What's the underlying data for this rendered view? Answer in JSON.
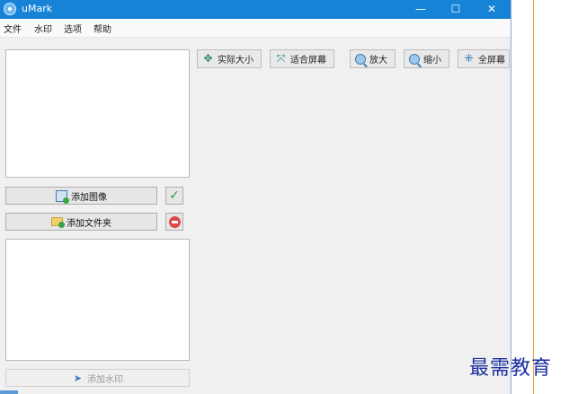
{
  "window": {
    "title": "uMark"
  },
  "window_controls": {
    "minimize": "—",
    "maximize": "☐",
    "close": "✕"
  },
  "menu": [
    "文件",
    "水印",
    "选项",
    "帮助"
  ],
  "left_panel": {
    "add_image_label": "添加图像",
    "add_folder_label": "添加文件夹",
    "add_watermark_label": "添加水印"
  },
  "toolbar": {
    "actual_size": "实际大小",
    "fit_screen": "适合屏幕",
    "zoom_in": "放大",
    "zoom_out": "缩小",
    "fullscreen": "全屏幕"
  },
  "icons": {
    "app": "umark-logo-icon",
    "add_image": "add-image-icon",
    "add_folder": "add-folder-icon",
    "confirm": "check-icon",
    "remove": "remove-icon",
    "watermark": "stamp-icon",
    "actual_size": "arrows-icon",
    "fit_screen": "fit-icon",
    "zoom_in": "zoom-in-icon",
    "zoom_out": "zoom-out-icon",
    "fullscreen": "fullscreen-icon"
  },
  "overlay": {
    "watermark_text": "最需教育"
  },
  "colors": {
    "titlebar": "#1783d7",
    "watermark_text": "#1c2f9e",
    "accent_line": "#e8a24a"
  }
}
